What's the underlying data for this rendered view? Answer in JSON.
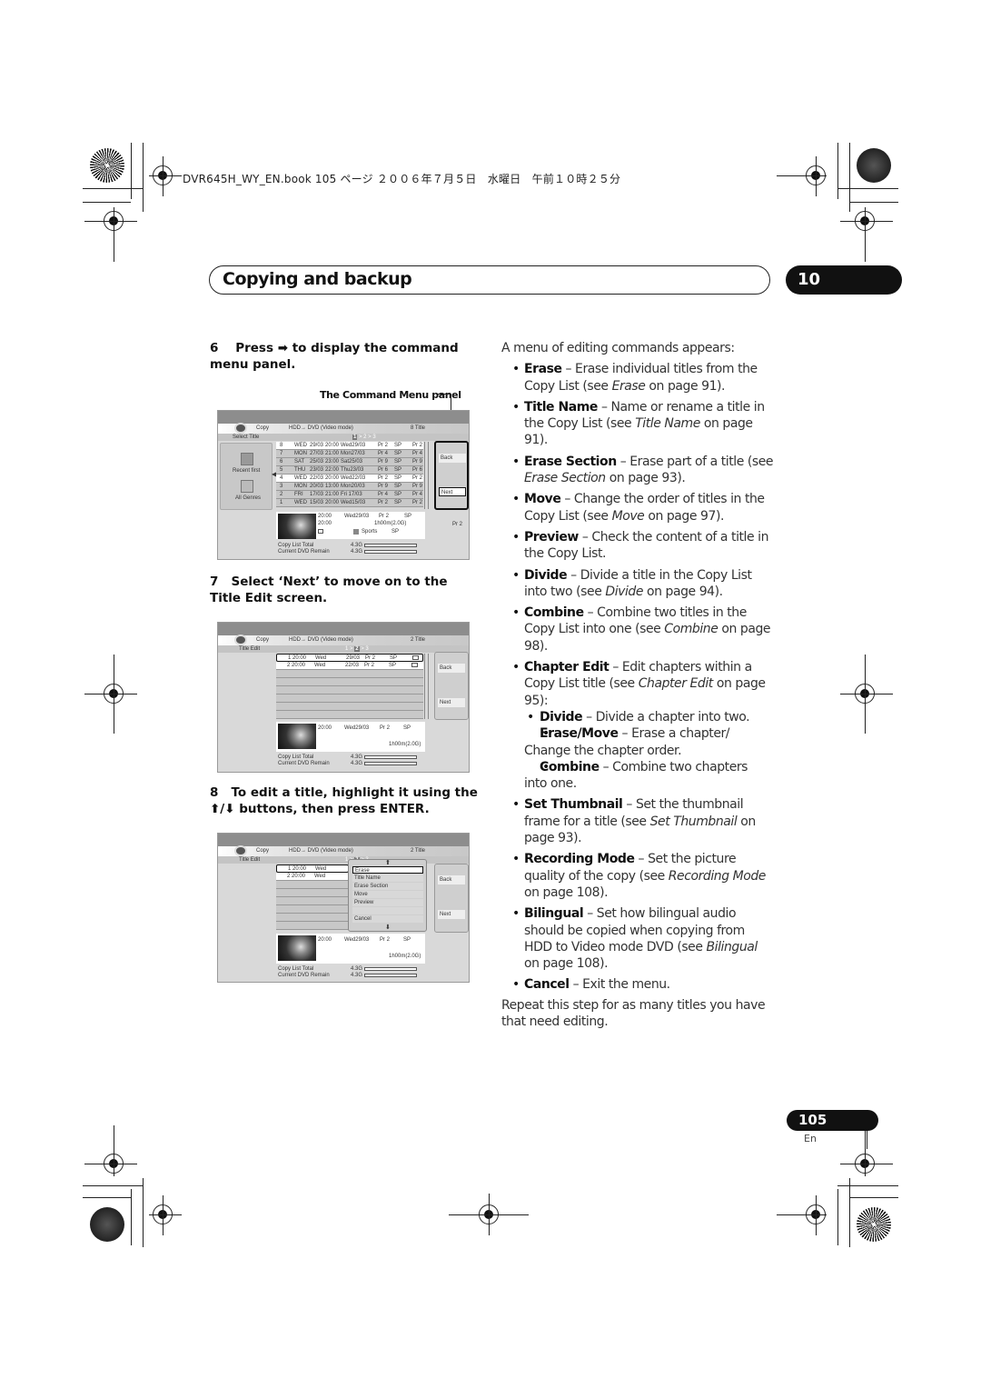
{
  "print_header": "DVR645H_WY_EN.book  105 ページ  ２００６年７月５日　水曜日　午前１０時２５分",
  "chapter": {
    "title": "Copying and backup",
    "number": "10"
  },
  "steps": [
    {
      "number": "6",
      "text_before": "Press",
      "icon": "right-arrow-icon",
      "icon_glyph": "➡",
      "text_after": "to display the command menu panel."
    },
    {
      "number": "7",
      "text": "Select ‘Next’ to move on to the Title Edit screen."
    },
    {
      "number": "8",
      "text_before": "To edit a title, highlight it using the",
      "icon_glyph": "⬆/⬇",
      "text_after": "buttons, then press ENTER."
    }
  ],
  "callout_label": "The Command Menu panel",
  "screens": {
    "common": {
      "copy": "Copy",
      "mode": "HDD→  DVD  (Video  mode)",
      "copy_list_total_label": "Copy  List  Total",
      "copy_list_total_value": "4.3G",
      "dvd_remain_label": "Current  DVD  Remain",
      "dvd_remain_value": "4.3G",
      "back": "Back",
      "next": "Next"
    },
    "select_title": {
      "count": "8   Title",
      "subtitle": "Select  Title",
      "pager": [
        "1",
        "2",
        "3"
      ],
      "pager_active": "1",
      "left_options": [
        "Recent  first",
        "All  Genres"
      ],
      "rows": [
        {
          "n": "8",
          "day": "WED",
          "date": "29/03",
          "time": "20:00",
          "rec": "Wed29/03",
          "ch": "Pr  2",
          "mode": "SP",
          "pr": "Pr  2",
          "highlight": true
        },
        {
          "n": "7",
          "day": "MON",
          "date": "27/03",
          "time": "21:00",
          "rec": "Mon27/03",
          "ch": "Pr  4",
          "mode": "SP",
          "pr": "Pr  4",
          "highlight": false
        },
        {
          "n": "6",
          "day": "SAT",
          "date": "25/03",
          "time": "23:00",
          "rec": "Sat25/03",
          "ch": "Pr  9",
          "mode": "SP",
          "pr": "Pr  9",
          "highlight": false
        },
        {
          "n": "5",
          "day": "THU",
          "date": "23/03",
          "time": "22:00",
          "rec": "Thu23/03",
          "ch": "Pr  6",
          "mode": "SP",
          "pr": "Pr  6",
          "highlight": false
        },
        {
          "n": "4",
          "day": "WED",
          "date": "22/03",
          "time": "20:00",
          "rec": "Wed22/03",
          "ch": "Pr  2",
          "mode": "SP",
          "pr": "Pr  2",
          "highlight": true
        },
        {
          "n": "3",
          "day": "MON",
          "date": "20/03",
          "time": "13:00",
          "rec": "Mon20/03",
          "ch": "Pr  9",
          "mode": "SP",
          "pr": "Pr  9",
          "highlight": false
        },
        {
          "n": "2",
          "day": "FRI",
          "date": "17/03",
          "time": "21:00",
          "rec": "Fri 17/03",
          "ch": "Pr  4",
          "mode": "SP",
          "pr": "Pr  4",
          "highlight": false
        },
        {
          "n": "1",
          "day": "WED",
          "date": "15/03",
          "time": "20:00",
          "rec": "Wed15/03",
          "ch": "Pr  2",
          "mode": "SP",
          "pr": "Pr  2",
          "highlight": false
        }
      ],
      "info": {
        "time1": "20:00",
        "date": "Wed29/03",
        "ch": "Pr  2",
        "mode": "SP",
        "time2": "20:00",
        "duration": "1h00m(2.0G)",
        "genre": "Sports",
        "genre_mode": "SP",
        "pr_right": "Pr  2"
      }
    },
    "title_edit": {
      "count": "2   Title",
      "subtitle": "Title  Edit",
      "pager": [
        "1",
        "2",
        "3"
      ],
      "pager_active": "2",
      "rows": [
        {
          "n": "1",
          "time": "20:00",
          "day": "Wed",
          "date": "29/03",
          "ch": "Pr  2",
          "mode": "SP"
        },
        {
          "n": "2",
          "time": "20:00",
          "day": "Wed",
          "date": "22/03",
          "ch": "Pr  2",
          "mode": "SP"
        }
      ],
      "info": {
        "time": "20:00",
        "date": "Wed29/03",
        "ch": "Pr  2",
        "mode": "SP",
        "duration": "1h00m(2.0G)"
      }
    },
    "command_menu": {
      "items": [
        "Erase",
        "Title  Name",
        "Erase  Section",
        "Move",
        "Preview",
        "",
        "Cancel"
      ],
      "selected": "Erase"
    }
  },
  "right_column": {
    "intro": "A menu of editing commands appears:",
    "items": [
      {
        "term": "Erase",
        "desc": " – Erase individual titles from the Copy List (see ",
        "ref": "Erase",
        "tail": " on page 91)."
      },
      {
        "term": "Title Name",
        "desc": " – Name or rename a title in the Copy List (see ",
        "ref": "Title Name",
        "tail": " on page 91)."
      },
      {
        "term": "Erase Section",
        "desc": " – Erase part of a title (see ",
        "ref": "Erase Section",
        "tail": " on page 93)."
      },
      {
        "term": "Move",
        "desc": " – Change the order of titles in the Copy List (see ",
        "ref": "Move",
        "tail": " on page 97)."
      },
      {
        "term": "Preview",
        "desc": " – Check the content of a title in the Copy List.",
        "ref": "",
        "tail": ""
      },
      {
        "term": "Divide",
        "desc": " – Divide a title in the Copy List into two (see ",
        "ref": "Divide",
        "tail": " on page 94)."
      },
      {
        "term": "Combine",
        "desc": " – Combine two titles in the Copy List into one (see ",
        "ref": "Combine",
        "tail": " on page 98)."
      },
      {
        "term": "Chapter Edit",
        "desc": " – Edit chapters within a Copy List title (see ",
        "ref": "Chapter Edit",
        "tail": " on page 95):"
      }
    ],
    "chapter_sub": [
      {
        "term": "Divide",
        "desc": " – Divide a chapter into two."
      },
      {
        "term": "Erase/Move",
        "desc": " – Erase a chapter/ Change the chapter order."
      },
      {
        "term": "Combine",
        "desc": " – Combine two chapters into one."
      }
    ],
    "items2": [
      {
        "term": "Set Thumbnail",
        "desc": " – Set the thumbnail frame for a title (see ",
        "ref": "Set Thumbnail",
        "tail": " on page 93)."
      },
      {
        "term": "Recording Mode",
        "desc": " – Set the picture quality of the copy (see ",
        "ref": "Recording Mode",
        "tail": " on page 108)."
      },
      {
        "term": "Bilingual",
        "desc": " – Set how bilingual audio should be copied when copying from HDD to Video mode DVD (see ",
        "ref": "Bilingual",
        "tail": " on page 108)."
      },
      {
        "term": "Cancel",
        "desc": " – Exit the menu.",
        "ref": "",
        "tail": ""
      }
    ],
    "outro": "Repeat this step for as many titles you have that need editing."
  },
  "footer": {
    "page_number": "105",
    "language": "En"
  }
}
